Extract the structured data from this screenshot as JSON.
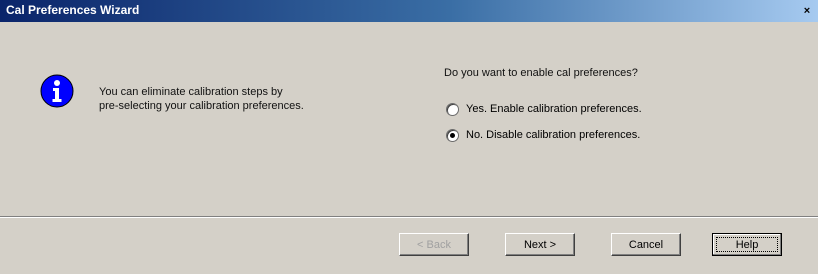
{
  "window": {
    "title": "Cal Preferences Wizard",
    "close_glyph": "×"
  },
  "info": {
    "icon": "info-icon",
    "message_line1": "You can eliminate calibration steps by",
    "message_line2": "pre-selecting your calibration preferences."
  },
  "prompt": {
    "question": "Do you want to enable cal preferences?",
    "options": [
      {
        "label": "Yes.  Enable calibration preferences.",
        "checked": false
      },
      {
        "label": "No.  Disable calibration preferences.",
        "checked": true
      }
    ]
  },
  "buttons": {
    "back": "< Back",
    "next": "Next >",
    "cancel": "Cancel",
    "help": "Help"
  },
  "colors": {
    "titlebar_start": "#0a246a",
    "titlebar_end": "#a6caf0",
    "dialog_face": "#d4d0c8",
    "info_blue": "#0000ff"
  }
}
